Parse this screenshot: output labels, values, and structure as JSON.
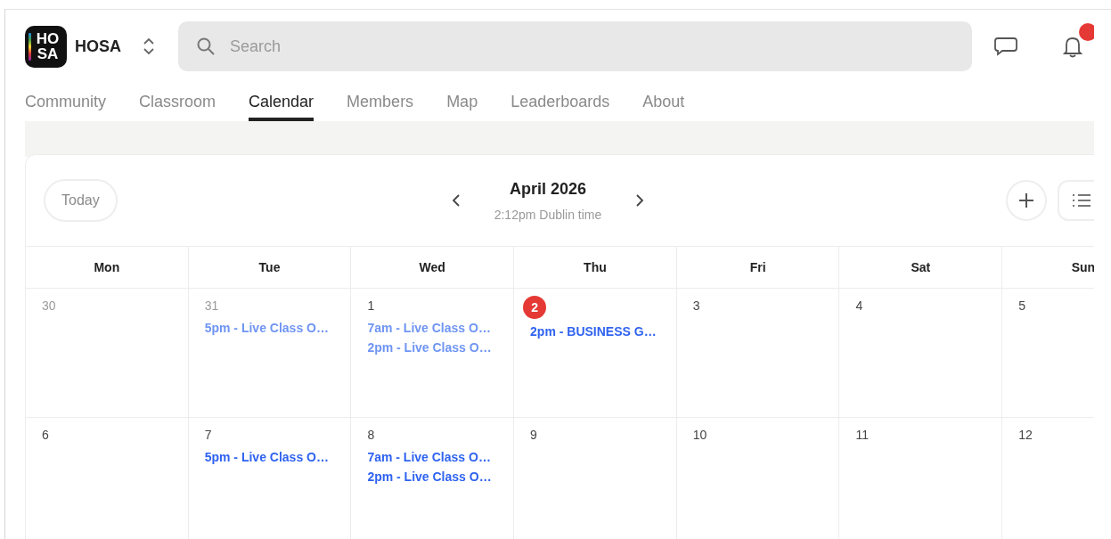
{
  "community": {
    "logo_lines": [
      "HO",
      "SA"
    ],
    "name": "HOSA"
  },
  "search": {
    "placeholder": "Search"
  },
  "notifications": {
    "unread": true
  },
  "tabs": [
    {
      "label": "Community",
      "selected": false
    },
    {
      "label": "Classroom",
      "selected": false
    },
    {
      "label": "Calendar",
      "selected": true
    },
    {
      "label": "Members",
      "selected": false
    },
    {
      "label": "Map",
      "selected": false
    },
    {
      "label": "Leaderboards",
      "selected": false
    },
    {
      "label": "About",
      "selected": false
    }
  ],
  "calendar": {
    "today_button": "Today",
    "month": "April 2026",
    "local_time": "2:12pm Dublin time",
    "weekdays": [
      "Mon",
      "Tue",
      "Wed",
      "Thu",
      "Fri",
      "Sat",
      "Sun"
    ],
    "weeks": [
      [
        {
          "date": "30",
          "outside_month": true,
          "today": false
        },
        {
          "date": "31",
          "outside_month": true,
          "today": false,
          "events": [
            {
              "title": "5pm - Live Class O…",
              "past": true
            }
          ]
        },
        {
          "date": "1",
          "outside_month": false,
          "today": false,
          "events": [
            {
              "title": "7am - Live Class O…",
              "past": true
            },
            {
              "title": "2pm - Live Class O…",
              "past": true
            }
          ]
        },
        {
          "date": "2",
          "outside_month": false,
          "today": true,
          "events": [
            {
              "title": "2pm - BUSINESS G…",
              "past": false
            }
          ]
        },
        {
          "date": "3",
          "outside_month": false,
          "today": false
        },
        {
          "date": "4",
          "outside_month": false,
          "today": false
        },
        {
          "date": "5",
          "outside_month": false,
          "today": false
        }
      ],
      [
        {
          "date": "6",
          "outside_month": false,
          "today": false
        },
        {
          "date": "7",
          "outside_month": false,
          "today": false,
          "events": [
            {
              "title": "5pm - Live Class O…",
              "past": false
            }
          ]
        },
        {
          "date": "8",
          "outside_month": false,
          "today": false,
          "events": [
            {
              "title": "7am - Live Class O…",
              "past": false
            },
            {
              "title": "2pm - Live Class O…",
              "past": false
            }
          ]
        },
        {
          "date": "9",
          "outside_month": false,
          "today": false
        },
        {
          "date": "10",
          "outside_month": false,
          "today": false
        },
        {
          "date": "11",
          "outside_month": false,
          "today": false
        },
        {
          "date": "12",
          "outside_month": false,
          "today": false
        }
      ]
    ]
  }
}
